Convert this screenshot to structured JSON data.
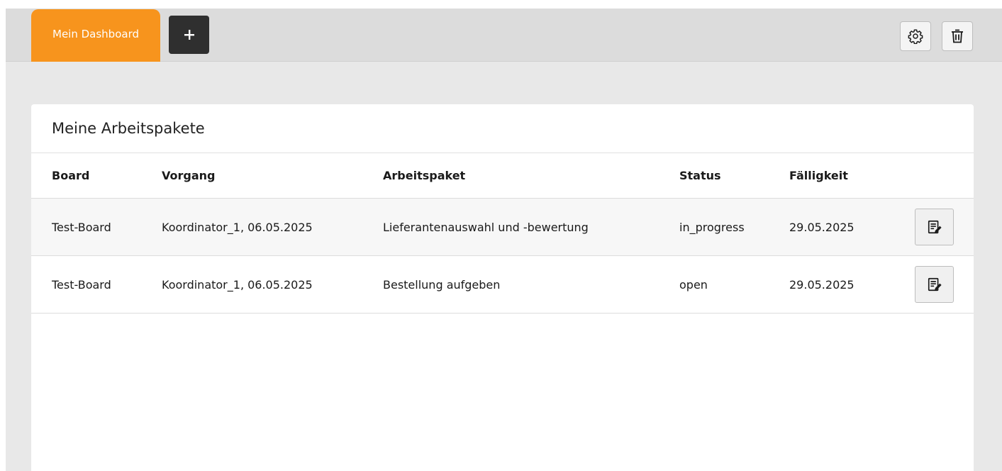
{
  "tabs": {
    "active_label": "Mein Dashboard",
    "add_icon": "plus-icon"
  },
  "toolbar": {
    "settings_icon": "gear-icon",
    "delete_icon": "trash-icon"
  },
  "widget": {
    "title": "Meine Arbeitspakete",
    "columns": {
      "board": "Board",
      "vorgang": "Vorgang",
      "arbeitspaket": "Arbeitspaket",
      "status": "Status",
      "faelligkeit": "Fälligkeit"
    },
    "rows": [
      {
        "board": "Test-Board",
        "vorgang": "Koordinator_1, 06.05.2025",
        "arbeitspaket": "Lieferantenauswahl und -bewertung",
        "status": "in_progress",
        "faelligkeit": "29.05.2025",
        "action_icon": "edit-note-icon"
      },
      {
        "board": "Test-Board",
        "vorgang": "Koordinator_1, 06.05.2025",
        "arbeitspaket": "Bestellung aufgeben",
        "status": "open",
        "faelligkeit": "29.05.2025",
        "action_icon": "edit-note-icon"
      }
    ]
  },
  "colors": {
    "accent": "#f7941d",
    "dark_button": "#2f2f2f",
    "background": "#e8e8e8",
    "topbar": "#dcdcdc"
  }
}
